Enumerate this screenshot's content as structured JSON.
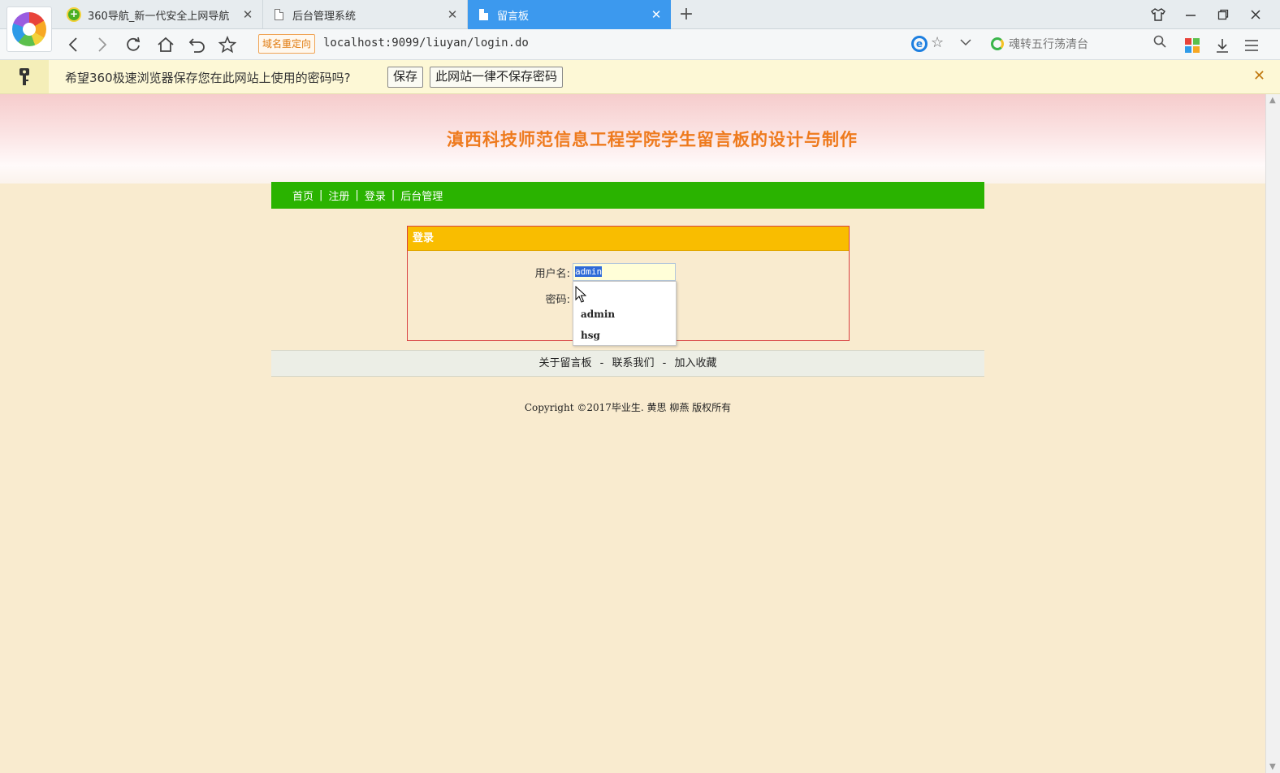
{
  "browser": {
    "tabs": [
      {
        "label": "360导航_新一代安全上网导航",
        "active": false
      },
      {
        "label": "后台管理系统",
        "active": false
      },
      {
        "label": "留言板",
        "active": true
      }
    ],
    "redirect_tag": "域名重定向",
    "url": "localhost:9099/liuyan/login.do",
    "search_placeholder": "魂转五行荡清台",
    "colors": {
      "active_tab": "#3c99ee",
      "chrome": "#e7ecef"
    }
  },
  "password_bar": {
    "message": "希望360极速浏览器保存您在此网站上使用的密码吗?",
    "save_label": "保存",
    "never_label": "此网站一律不保存密码",
    "close_glyph": "✕"
  },
  "page": {
    "title": "滇西科技师范信息工程学院学生留言板的设计与制作",
    "nav": [
      "首页",
      "注册",
      "登录",
      "后台管理"
    ],
    "nav_separator": "|",
    "login": {
      "header": "登录",
      "username_label": "用户名:",
      "username_value": "admin",
      "password_label": "密码:"
    },
    "autocomplete": [
      "admin",
      "hsg"
    ],
    "footer": {
      "about": "关于留言板",
      "contact": "联系我们",
      "bookmark": "加入收藏",
      "separator": "-"
    },
    "copyright": "Copyright ©2017毕业生. 黄思 柳燕 版权所有",
    "colors": {
      "background": "#f9ebcf",
      "title": "#ee7a1d",
      "nav": "#2ab300",
      "login_header": "#f9bd00",
      "login_border": "#d84040"
    }
  }
}
